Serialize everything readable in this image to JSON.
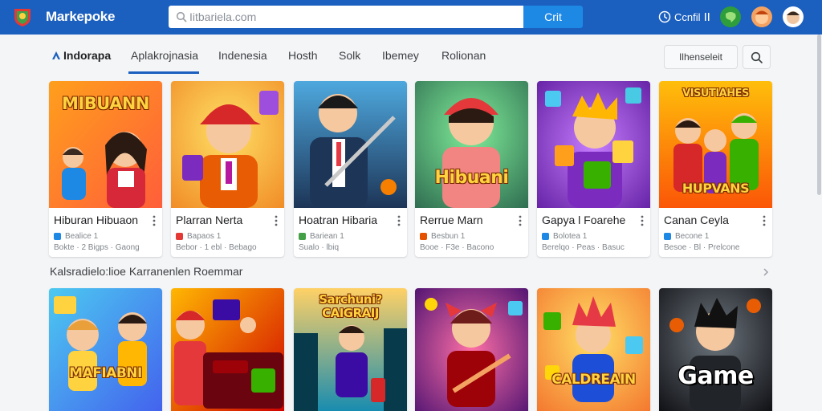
{
  "header": {
    "brand": "Markepoke",
    "search_placeholder": "Iitbariela.com",
    "search_button": "Crit",
    "account_label": "Ccnfil",
    "colors": {
      "bar": "#1b5fbf",
      "button": "#1e88e5"
    }
  },
  "tabs": [
    {
      "label": "Indorapa",
      "active": false
    },
    {
      "label": "Aplakrojnasia",
      "active": true
    },
    {
      "label": "Indenesia",
      "active": false
    },
    {
      "label": "Hosth",
      "active": false
    },
    {
      "label": "Solk",
      "active": false
    },
    {
      "label": "Ibemey",
      "active": false
    },
    {
      "label": "Rolionan",
      "active": false
    }
  ],
  "filter_button": "Ilhenseleit",
  "row1": [
    {
      "title": "Hiburan Hibuaon",
      "meta1": "Bealice  1",
      "meta2": "Bokte  · 2 Bigps  · Gaong",
      "art_text": "MIBUANN",
      "accent": "#1e88e5"
    },
    {
      "title": "Plarran Nerta",
      "meta1": "Bapaos  1",
      "meta2": "Bebor  · 1 ebl  ·  Bebago",
      "art_text": "",
      "accent": "#e53935"
    },
    {
      "title": "Hoatran Hibaria",
      "meta1": "Bariean  1",
      "meta2": "Sualo  ·  lbiq",
      "art_text": "",
      "accent": "#43a047"
    },
    {
      "title": "Rerrue Marn",
      "meta1": "Besbun  1",
      "meta2": "Booe  ·  F3e  ·  Bacono",
      "art_text": "Hibuani",
      "accent": "#e65100"
    },
    {
      "title": "Gapya l Foarehe",
      "meta1": "Bolotea  1",
      "meta2": "Berelqo  ·  Peas  ·  Basuc",
      "art_text": "",
      "accent": "#1e88e5"
    },
    {
      "title": "Canan Ceyla",
      "meta1": "Becone  1",
      "meta2": "Besoe  ·  Bl  ·  Prelcone",
      "art_text": "HUPVANS",
      "accent": "#1e88e5"
    }
  ],
  "row1_banner": "VISUTIAHES",
  "section_title": "Kalsradielo:lioe Karranenlen Roemmar",
  "row2": [
    {
      "art_text": "MAFIABNI",
      "top_text": ""
    },
    {
      "art_text": "",
      "top_text": ""
    },
    {
      "art_text": "",
      "top_text": "Sarchuni? CAIGRAIJ"
    },
    {
      "art_text": "",
      "top_text": ""
    },
    {
      "art_text": "CALDREAIN",
      "top_text": ""
    },
    {
      "art_text": "Game",
      "top_text": ""
    }
  ]
}
